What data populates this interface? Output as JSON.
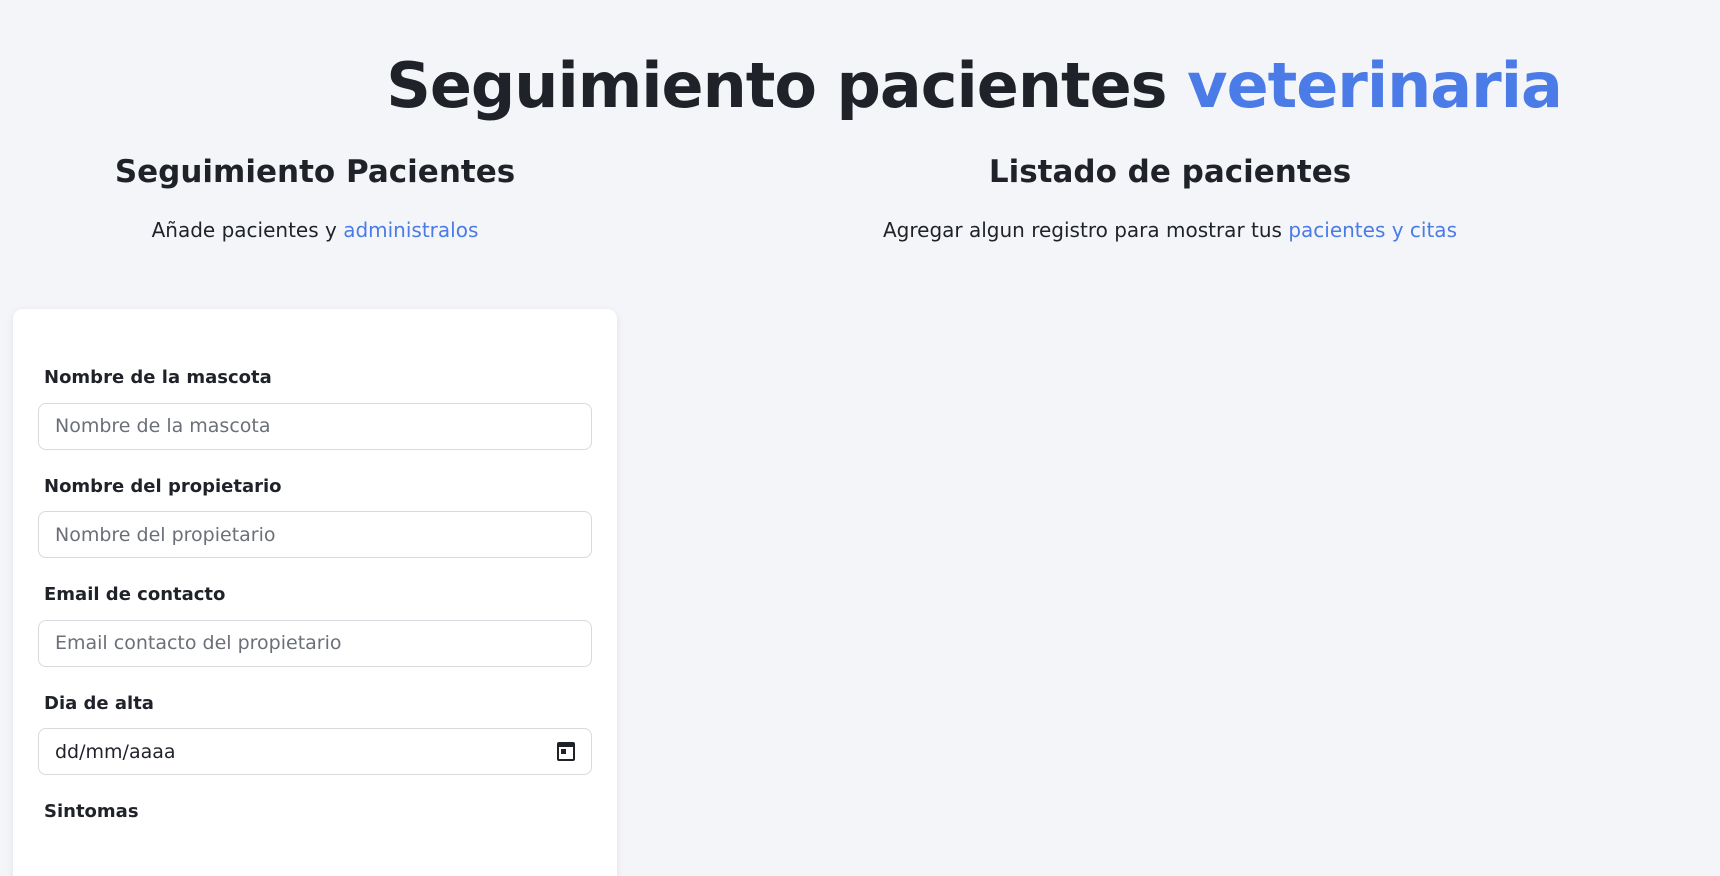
{
  "header": {
    "title_main": "Seguimiento pacientes ",
    "title_accent": "veterinaria"
  },
  "left": {
    "title": "Seguimiento Pacientes",
    "subtitle_text": "Añade pacientes y ",
    "subtitle_accent": "administralos"
  },
  "right": {
    "title": "Listado de pacientes",
    "subtitle_text": "Agregar algun registro para mostrar tus ",
    "subtitle_accent": "pacientes y citas"
  },
  "form": {
    "pet_name": {
      "label": "Nombre de la mascota",
      "placeholder": "Nombre de la mascota"
    },
    "owner_name": {
      "label": "Nombre del propietario",
      "placeholder": "Nombre del propietario"
    },
    "email": {
      "label": "Email de contacto",
      "placeholder": "Email contacto del propietario"
    },
    "discharge_date": {
      "label": "Dia de alta",
      "placeholder": "dd/mm/aaaa"
    },
    "symptoms": {
      "label": "Sintomas"
    }
  },
  "colors": {
    "accent": "#4a7be6",
    "background": "#f4f5f8",
    "text": "#1f2329"
  }
}
